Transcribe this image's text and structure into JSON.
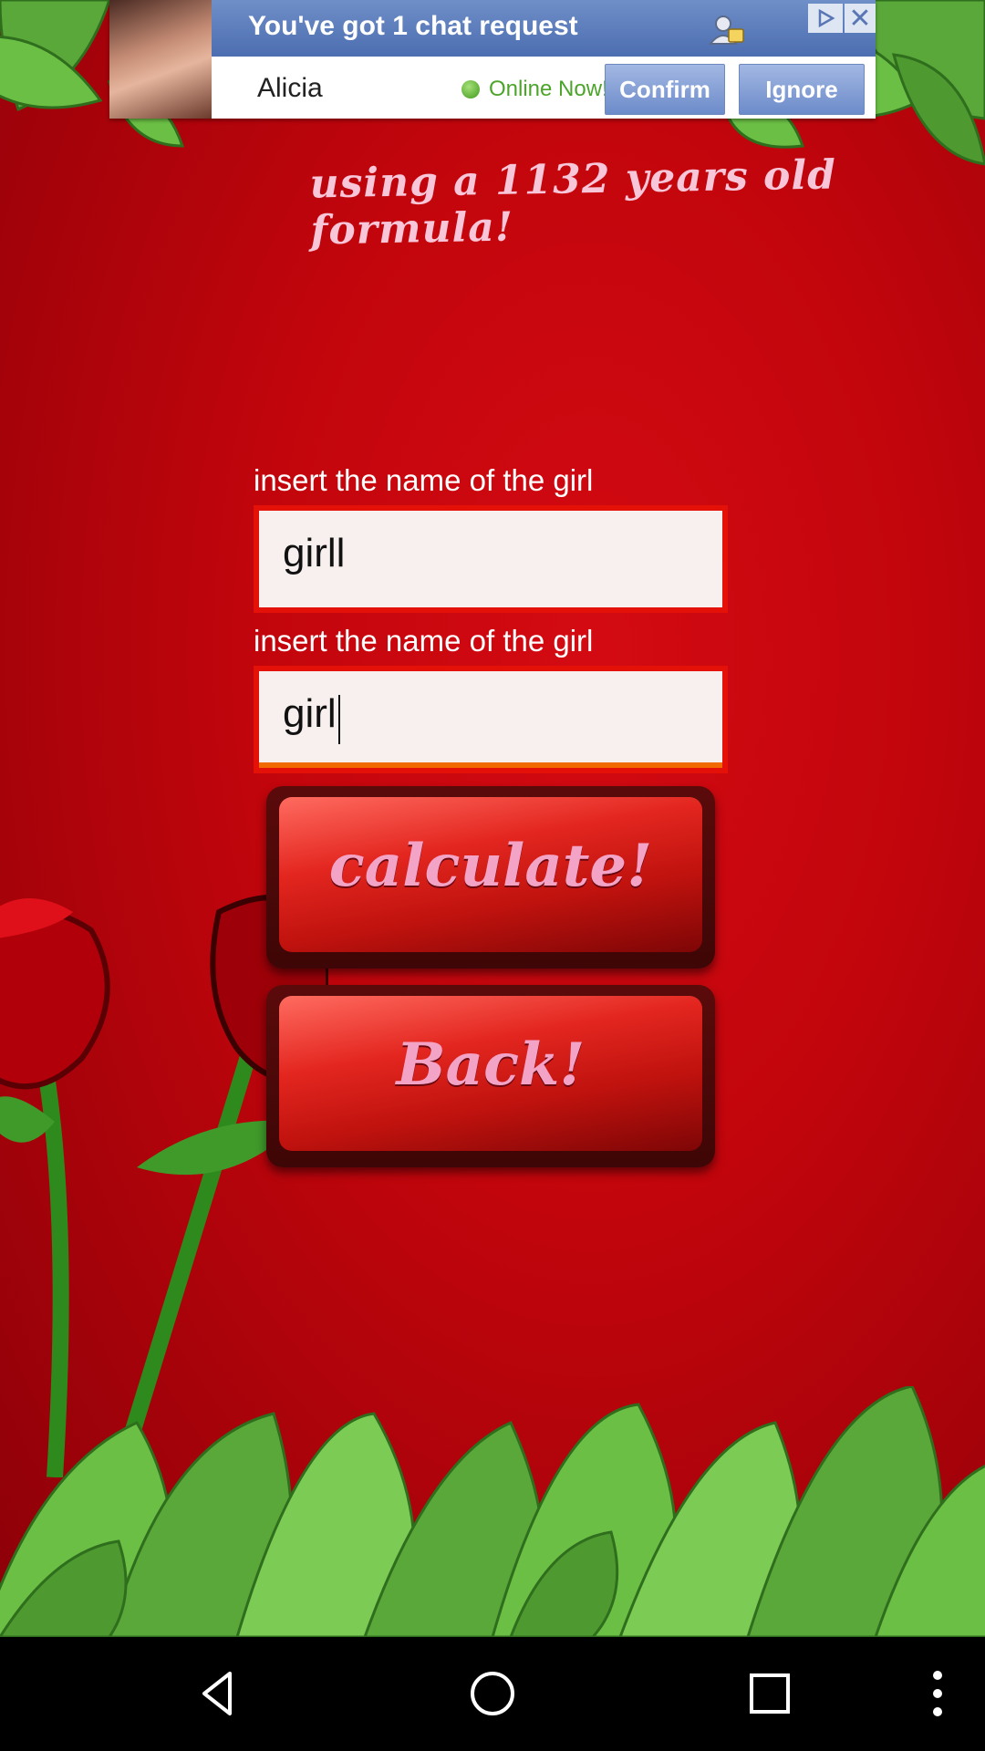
{
  "ad": {
    "title": "You've got 1 chat request",
    "name": "Alicia",
    "status": "Online Now!",
    "confirm_label": "Confirm",
    "ignore_label": "Ignore",
    "close_glyph": "✕"
  },
  "tagline": "using a 1132 years old formula!",
  "form": {
    "field1_label": "insert the name of the girl",
    "field1_value": "girll",
    "field2_label": "insert the name of the girl",
    "field2_value": "girl"
  },
  "buttons": {
    "calculate_label": "calculate!",
    "back_label": "Back!"
  },
  "nav": {
    "items": [
      "back-icon",
      "home-icon",
      "recents-icon",
      "more-icon"
    ]
  },
  "colors": {
    "background": "#c2050c",
    "field_border": "#e41108",
    "focus_underline": "#f06a00",
    "button_label": "#f3a3c6"
  }
}
